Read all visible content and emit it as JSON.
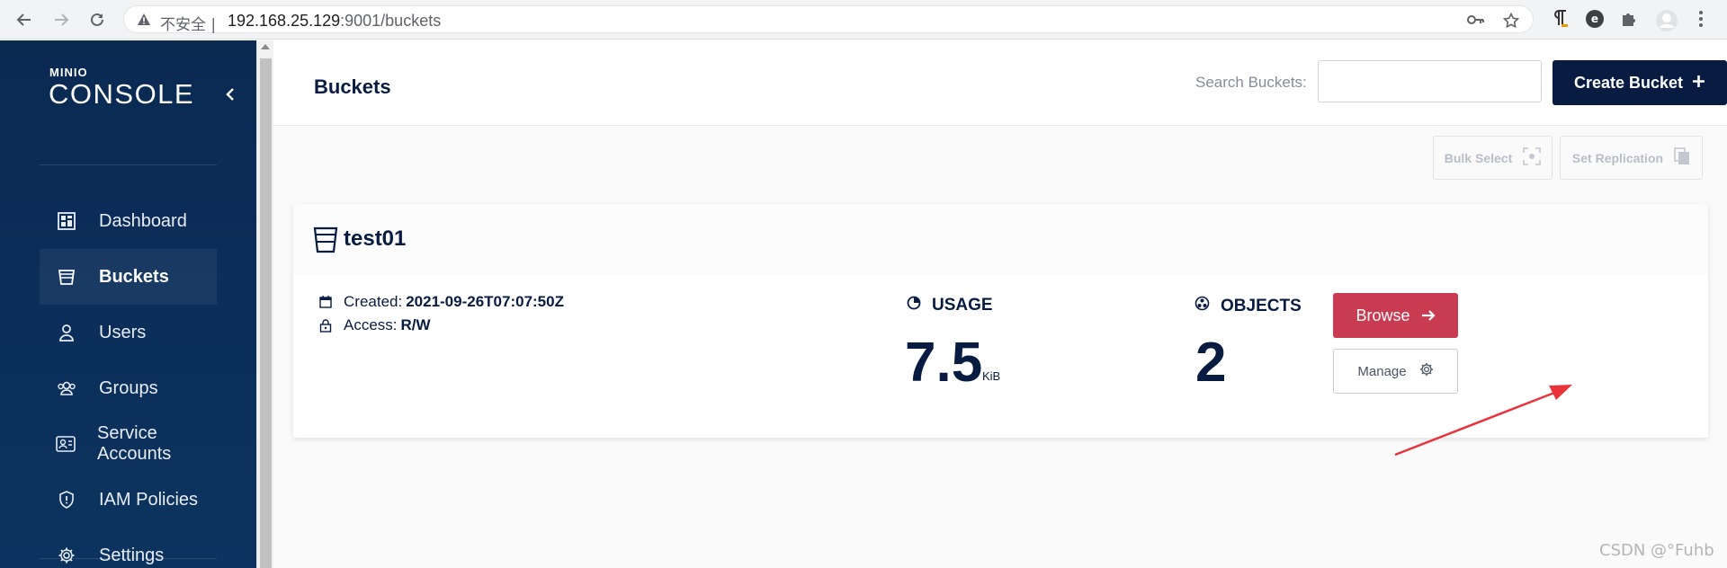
{
  "browser": {
    "insecure_label": "不安全",
    "url_host": "192.168.25.129",
    "url_path": ":9001/buckets"
  },
  "sidebar": {
    "logo_small": "MINIO",
    "logo_big": "CONSOLE",
    "items": [
      {
        "label": "Dashboard",
        "icon": "dashboard-icon"
      },
      {
        "label": "Buckets",
        "icon": "bucket-icon",
        "active": true
      },
      {
        "label": "Users",
        "icon": "user-icon"
      },
      {
        "label": "Groups",
        "icon": "groups-icon"
      },
      {
        "label": "Service Accounts",
        "icon": "service-accounts-icon"
      },
      {
        "label": "IAM Policies",
        "icon": "shield-icon"
      },
      {
        "label": "Settings",
        "icon": "gear-icon"
      }
    ]
  },
  "header": {
    "title": "Buckets",
    "search_label": "Search Buckets:",
    "search_value": "",
    "create_label": "Create Bucket"
  },
  "toolbar": {
    "bulk_select": "Bulk Select",
    "set_replication": "Set Replication"
  },
  "bucket": {
    "name": "test01",
    "created_label": "Created:",
    "created_value": "2021-09-26T07:07:50Z",
    "access_label": "Access:",
    "access_value": "R/W",
    "usage_title": "USAGE",
    "usage_value": "7.5",
    "usage_unit": "KiB",
    "objects_title": "OBJECTS",
    "objects_value": "2",
    "browse_label": "Browse",
    "manage_label": "Manage"
  },
  "watermark": "CSDN @°Fuhb",
  "colors": {
    "navy": "#081c42",
    "browse_red": "#c83b51",
    "annotation_red": "#e8333a"
  }
}
